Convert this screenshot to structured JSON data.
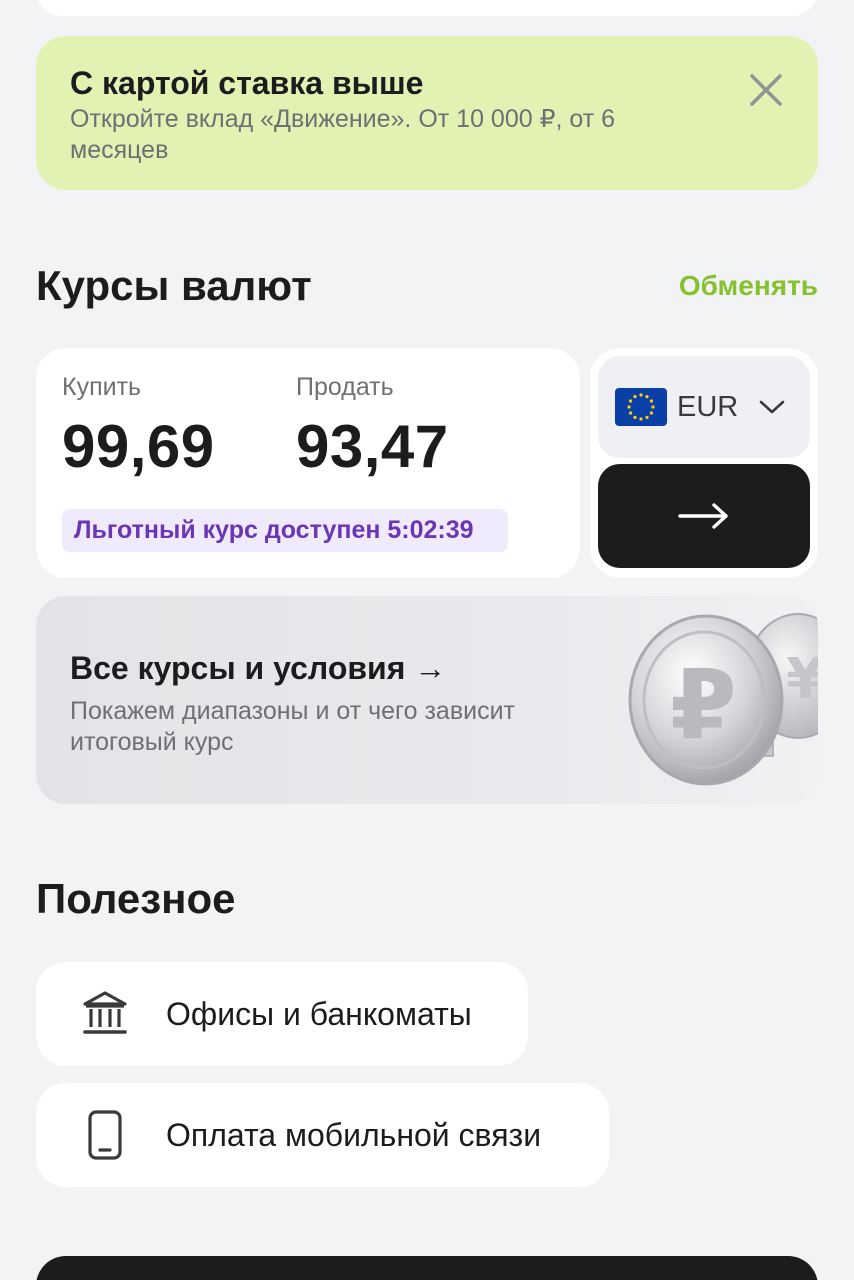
{
  "promo": {
    "title": "С картой ставка выше",
    "text": "Откройте вклад «Движение». От 10 000 ₽, от 6 месяцев",
    "close_icon": "close-icon"
  },
  "rates": {
    "section_title": "Курсы валют",
    "exchange_link": "Обменять",
    "buy_label": "Купить",
    "buy_value": "99,69",
    "sell_label": "Продать",
    "sell_value": "93,47",
    "promo_rate": "Льготный курс доступен 5:02:39",
    "currency": "EUR",
    "currency_icon": "eu-flag-icon",
    "go_icon": "arrow-right-icon"
  },
  "all_rates": {
    "title": "Все курсы и условия →",
    "text": "Покажем диапазоны и от чего зависит итоговый курс",
    "image_icon": "coins-illustration"
  },
  "useful": {
    "section_title": "Полезное",
    "items": [
      {
        "label": "Офисы и банкоматы",
        "icon": "bank-icon"
      },
      {
        "label": "Оплата мобильной связи",
        "icon": "phone-icon"
      }
    ]
  },
  "colors": {
    "background": "#f2f3f5",
    "promo_bg": "#e2f2b3",
    "accent_green": "#86c12f",
    "promo_rate_bg": "#efeafc",
    "promo_rate_text": "#6a36b6",
    "dark_button": "#1c1c1e"
  }
}
